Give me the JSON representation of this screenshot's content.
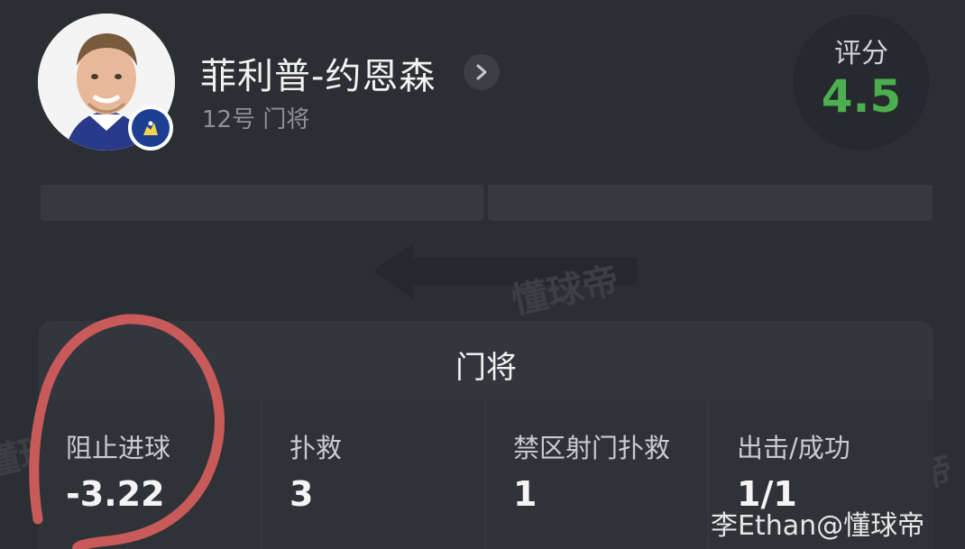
{
  "player": {
    "name": "菲利普-约恩森",
    "subtitle": "12号 门将"
  },
  "rating": {
    "label": "评分",
    "value": "4.5",
    "color": "#4cae4f"
  },
  "watermark": "懂球帝",
  "stats": {
    "title": "门将",
    "items": [
      {
        "label": "阻止进球",
        "value": "-3.22"
      },
      {
        "label": "扑救",
        "value": "3"
      },
      {
        "label": "禁区射门扑救",
        "value": "1"
      },
      {
        "label": "出击/成功",
        "value": "1/1"
      }
    ]
  },
  "credit": "李Ethan@懂球帝",
  "icons": {
    "avatar": "player-photo",
    "club": "chelsea-badge-icon",
    "detail": "chevron-right-icon",
    "arrow": "arrow-left-icon"
  }
}
